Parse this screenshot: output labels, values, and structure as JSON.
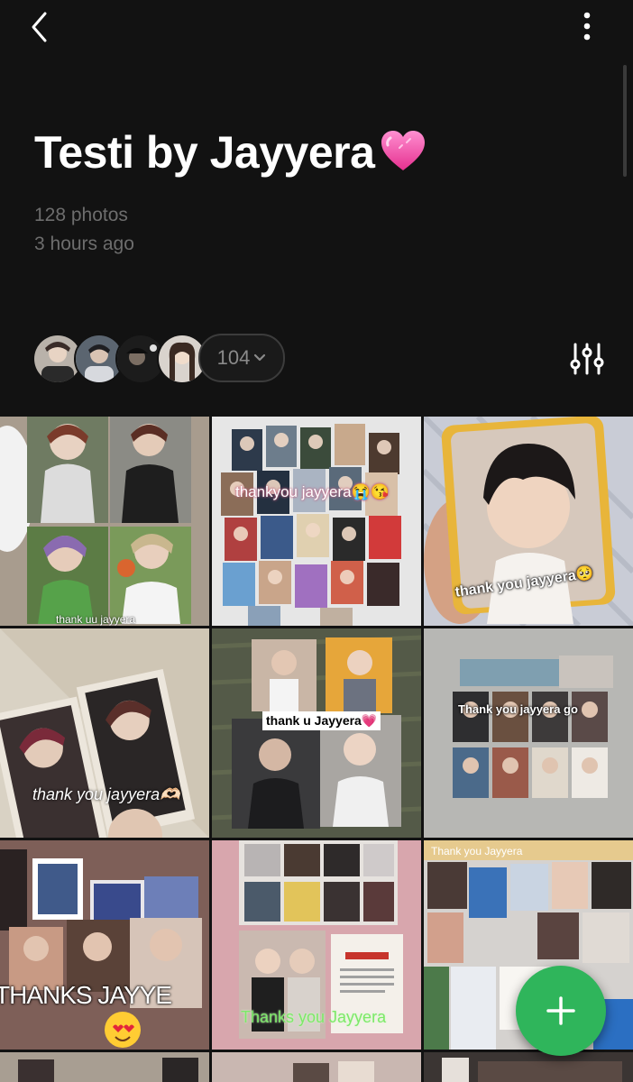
{
  "album": {
    "title": "Testi by Jayyera",
    "title_emoji": "heart-emoji",
    "photo_count": "128 photos",
    "updated": "3 hours ago",
    "member_count": "104"
  },
  "tiles": [
    {
      "caption": "thank uu jayyera"
    },
    {
      "caption": "thankyou jayyera😭😘"
    },
    {
      "caption": "thank you jayyera🥺"
    },
    {
      "caption": "thank you jayyera🫶🏻"
    },
    {
      "caption": "thank u Jayyera💗"
    },
    {
      "caption": "Thank you jayyera go"
    },
    {
      "caption": "THANKS JAYYE"
    },
    {
      "caption": "Thanks you Jayyera"
    },
    {
      "caption": "Thank you Jayyera"
    }
  ],
  "icons": {
    "back": "chevron-left-icon",
    "more": "more-vertical-icon",
    "filter": "sliders-icon",
    "count_chevron": "chevron-down-icon",
    "fab": "plus-icon"
  },
  "colors": {
    "background": "#121212",
    "accent": "#2fb55b",
    "muted_text": "#6d6d6d"
  }
}
